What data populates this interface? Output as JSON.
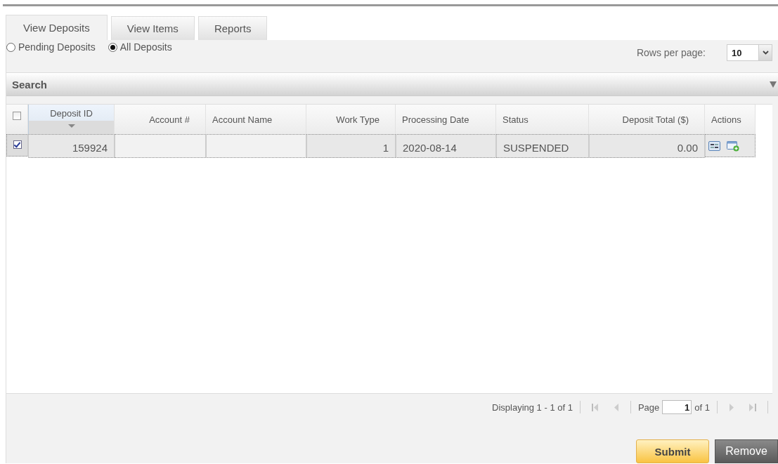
{
  "tabs": [
    {
      "label": "View Deposits",
      "selected": true
    },
    {
      "label": "View Items",
      "selected": false
    },
    {
      "label": "Reports",
      "selected": false
    }
  ],
  "filters": [
    {
      "label": "Pending Deposits",
      "selected": false
    },
    {
      "label": "All Deposits",
      "selected": true
    }
  ],
  "rows_per_page": {
    "label": "Rows per page:",
    "value": "10"
  },
  "search_panel": {
    "title": "Search"
  },
  "table": {
    "select_all_checked": false,
    "columns": [
      {
        "label": "Deposit ID",
        "sorted": true
      },
      {
        "label": "Account #",
        "sorted": false
      },
      {
        "label": "Account Name",
        "sorted": false
      },
      {
        "label": "Work Type",
        "sorted": false
      },
      {
        "label": "Processing Date",
        "sorted": false
      },
      {
        "label": "Status",
        "sorted": false
      },
      {
        "label": "Deposit Total ($)",
        "sorted": false
      },
      {
        "label": "Actions",
        "sorted": false
      }
    ],
    "rows": [
      {
        "checked": true,
        "selected": true,
        "cells": [
          "159924",
          "",
          "",
          "1",
          "2020-08-14",
          "SUSPENDED",
          "0.00"
        ]
      }
    ]
  },
  "pager": {
    "display": "Displaying 1 - 1 of 1",
    "page_label": "Page",
    "page": "1",
    "of": "of 1"
  },
  "buttons": [
    {
      "label": "Submit",
      "kind": "primary"
    },
    {
      "label": "Remove",
      "kind": "secondary"
    }
  ]
}
